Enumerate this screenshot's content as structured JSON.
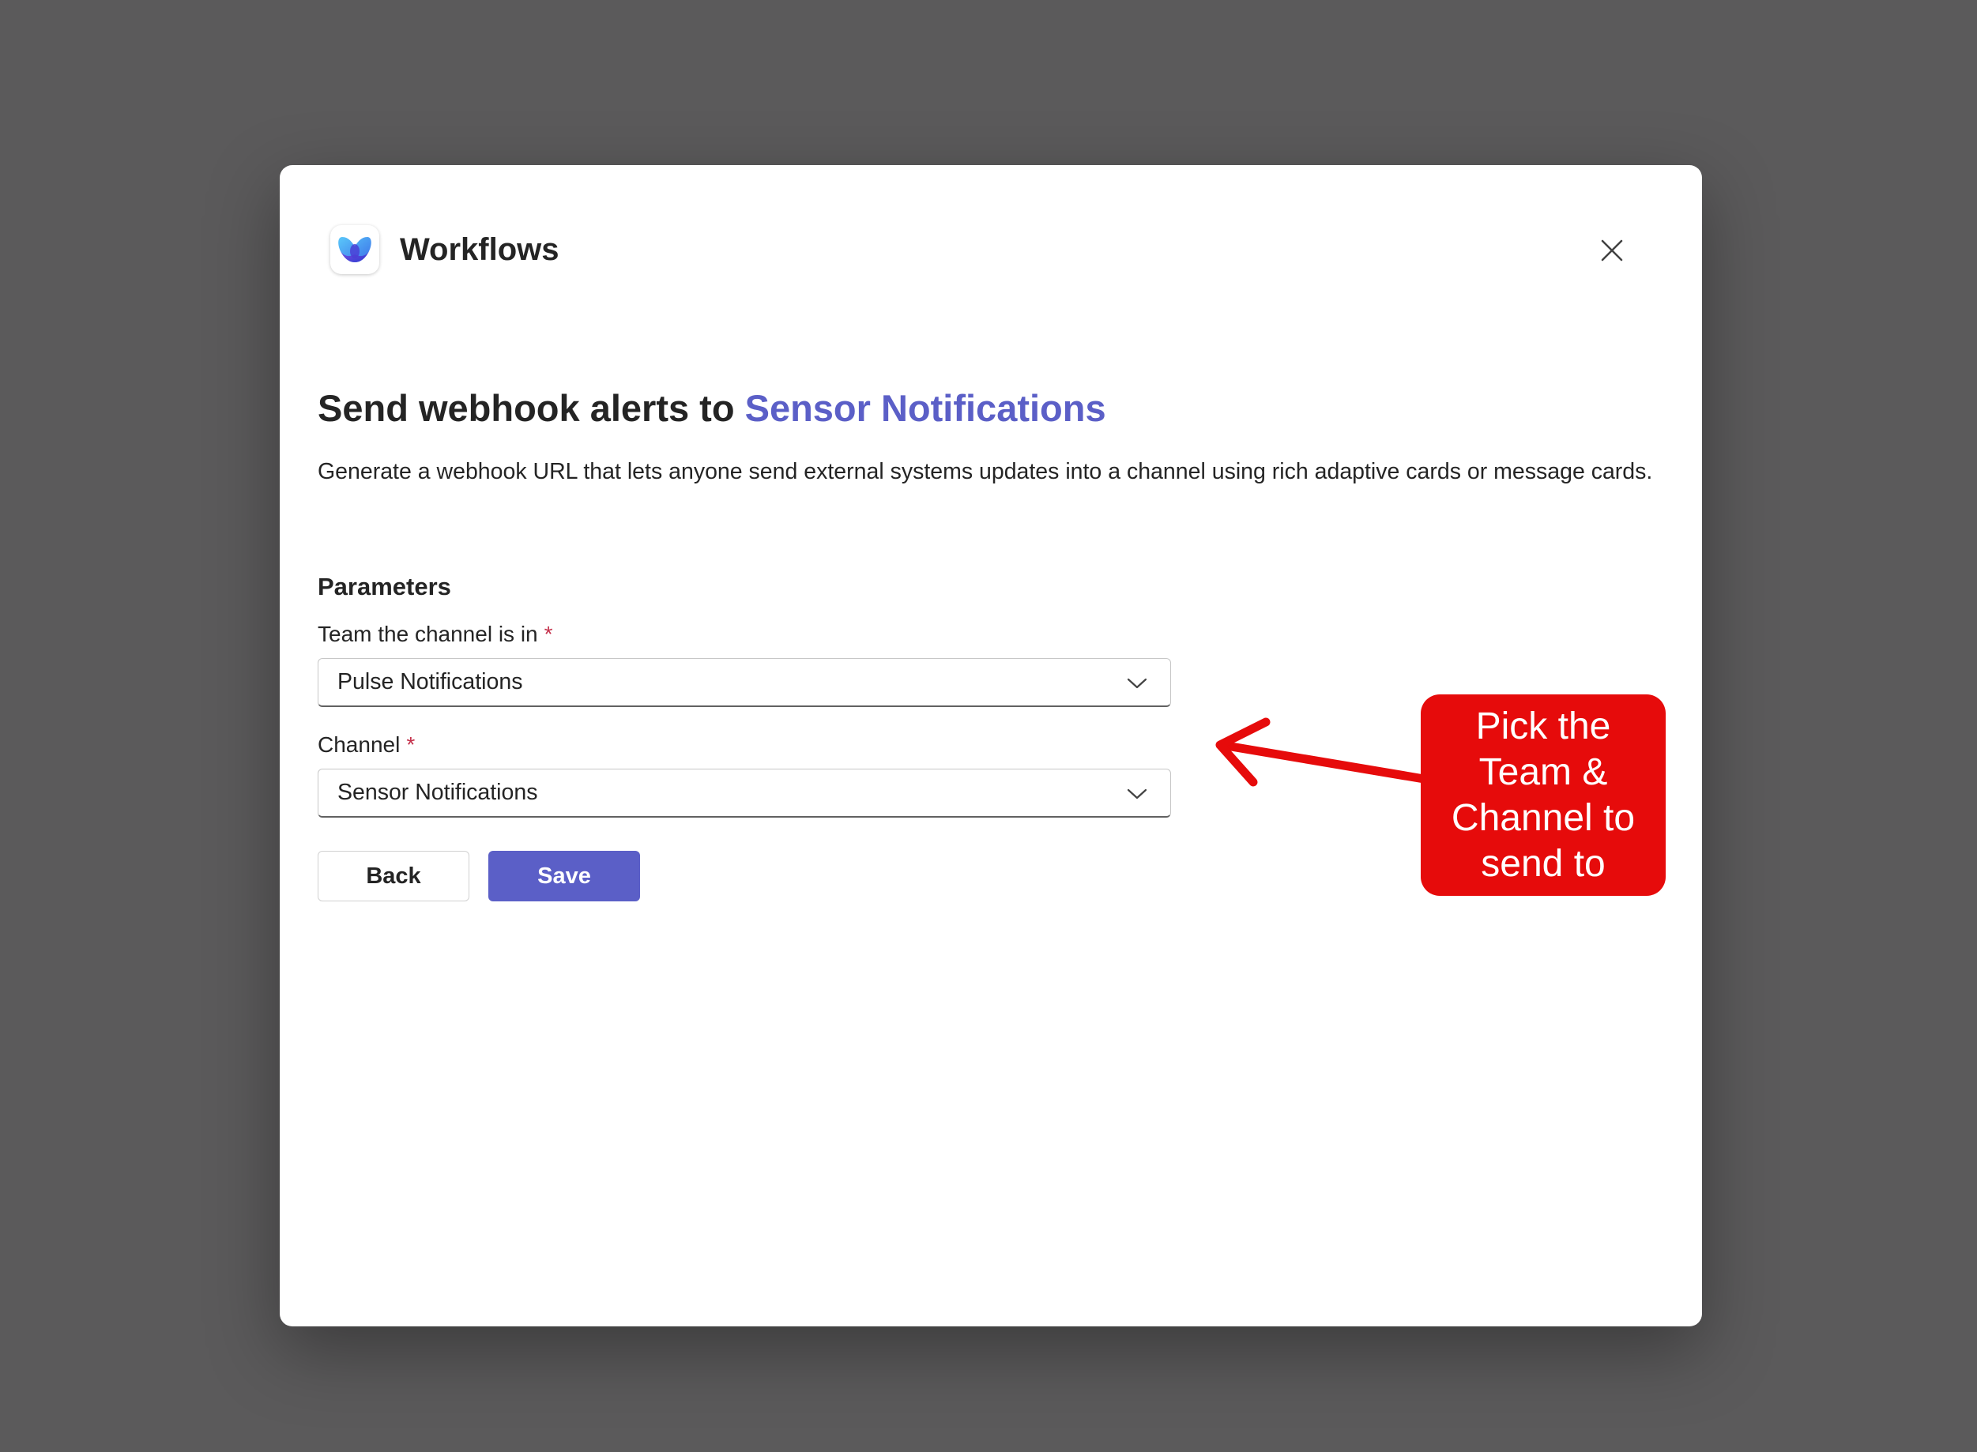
{
  "app": {
    "title": "Workflows",
    "logo_icon": "workflows-logo-icon"
  },
  "dialog": {
    "heading_prefix": "Send webhook alerts to ",
    "heading_highlight": "Sensor Notifications",
    "description": "Generate a webhook URL that lets anyone send external systems updates into a channel using rich adaptive cards or message cards.",
    "close_icon": "close-icon"
  },
  "parameters": {
    "section_title": "Parameters",
    "team": {
      "label": "Team the channel is in",
      "required_mark": "*",
      "value": "Pulse Notifications"
    },
    "channel": {
      "label": "Channel",
      "required_mark": "*",
      "value": "Sensor Notifications"
    }
  },
  "actions": {
    "back_label": "Back",
    "save_label": "Save"
  },
  "annotation": {
    "callout_text": "Pick the Team & Channel to send to",
    "arrow_icon": "arrow-left-icon"
  },
  "colors": {
    "background": "#5b5a5b",
    "accent": "#5b5fc7",
    "required": "#c4314b",
    "callout": "#e60b0b"
  }
}
